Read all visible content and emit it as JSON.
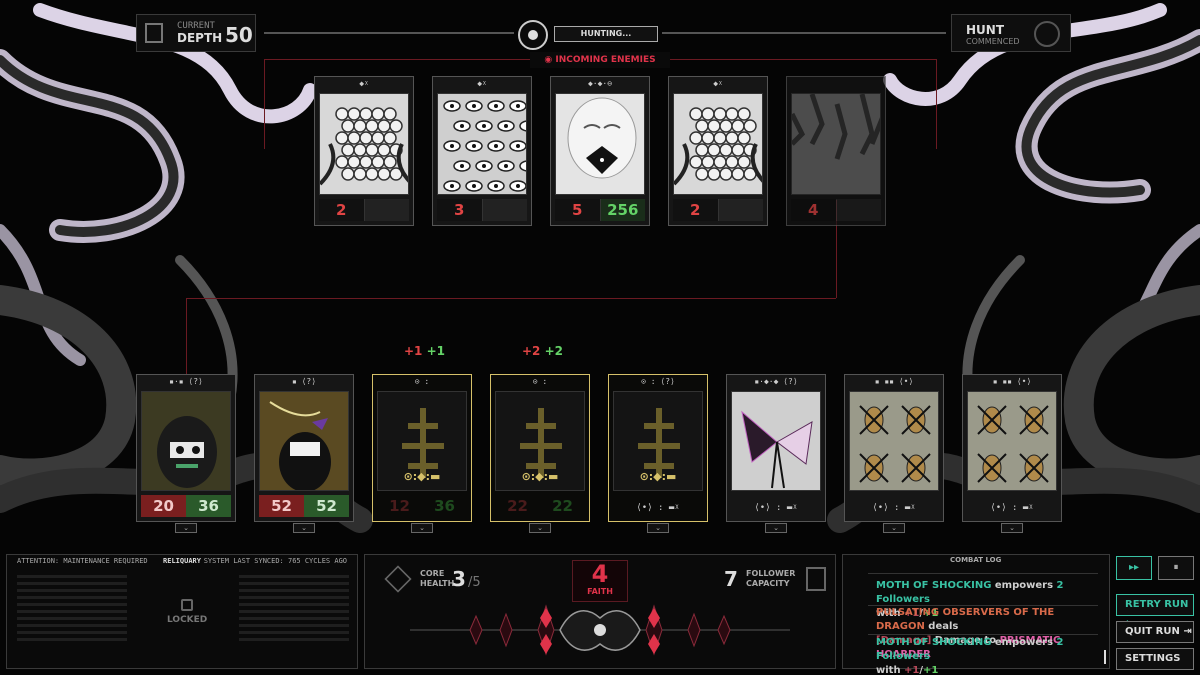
{
  "hud": {
    "depth_label1": "CURRENT",
    "depth_label2": "DEPTH",
    "depth_value": "50",
    "status": "HUNTING...",
    "hunt_label1": "HUNT",
    "hunt_label2": "COMMENCED",
    "incoming": "INCOMING ENEMIES"
  },
  "enemies": [
    {
      "icons": "◆ᵡ",
      "attack": "2",
      "health": "",
      "art": "nest-eggs"
    },
    {
      "icons": "◆ᵡ",
      "attack": "3",
      "health": "",
      "art": "eyes-cluster"
    },
    {
      "icons": "◆·◆·⊖",
      "attack": "5",
      "health": "256",
      "art": "prismatic-hoarder"
    },
    {
      "icons": "◆ᵡ",
      "attack": "2",
      "health": "",
      "art": "nest-eggs"
    },
    {
      "icons": "",
      "attack": "4",
      "health": "",
      "art": "claws-dim"
    }
  ],
  "followers": [
    {
      "icons": "▪·▪ ⟨?⟩",
      "attack": "20",
      "health": "36",
      "locked": false,
      "art": "crying-cultist"
    },
    {
      "icons": "▪ ⟨?⟩",
      "attack": "52",
      "health": "52",
      "locked": false,
      "art": "gold-wizard"
    },
    {
      "icons": "⊙ :",
      "attack": "12",
      "health": "36",
      "locked": true,
      "symbol": "⊙:◆:▬",
      "buff": "+1 +1"
    },
    {
      "icons": "⊙ :",
      "attack": "22",
      "health": "22",
      "locked": true,
      "symbol": "⊙:◆:▬",
      "buff": "+2 +2"
    },
    {
      "icons": "⊙ : ⟨?⟩",
      "attack": "",
      "health": "",
      "locked": true,
      "symbol": "⊙:◆:▬",
      "sym2": "⟨•⟩ : ▬ᵡ"
    },
    {
      "icons": "▪·◆·◆ ⟨?⟩",
      "attack": "",
      "health": "",
      "locked": false,
      "art": "moth-of-shocking",
      "sym2": "⟨•⟩ : ▬ᵡ"
    },
    {
      "icons": "▪ ▪▪ ⟨•⟩",
      "attack": "",
      "health": "",
      "locked": false,
      "art": "mosquito-swarm",
      "sym2": "⟨•⟩ : ▬ᵡ"
    },
    {
      "icons": "▪ ▪▪ ⟨•⟩",
      "attack": "",
      "health": "",
      "locked": false,
      "art": "mosquito-swarm",
      "sym2": "⟨•⟩ : ▬ᵡ"
    }
  ],
  "reliquary": {
    "title": "RELIQUARY",
    "left_header": "ATTENTION: MAINTENANCE REQUIRED",
    "right_header": "SYSTEM LAST SYNCED: 765 CYCLES AGO",
    "locked": "LOCKED"
  },
  "core": {
    "label1": "CORE",
    "label2": "HEALTH",
    "value": "3",
    "max": "/5"
  },
  "faith": {
    "value": "4",
    "label": "FAITH"
  },
  "follower_capacity": {
    "value": "7",
    "label1": "FOLLOWER",
    "label2": "CAPACITY"
  },
  "combat_log": {
    "title": "COMBAT LOG",
    "entries": [
      {
        "actor": "MOTH OF SHOCKING",
        "text1": " empowers ",
        "count": "2",
        "text2": " Followers",
        "text3": "with ",
        "buff1": "+1",
        "slash": "/",
        "buff2": "+1"
      },
      {
        "actor": "PULSATING OBSERVERS OF THE DRAGON",
        "text1": " deals ",
        "dmg": "[Damage]",
        "text2": " Damage to ",
        "target": "PRISMATIC HOARDER"
      },
      {
        "actor": "MOTH OF SHOCKING",
        "text1": " empowers ",
        "count": "2",
        "text2": " Followers",
        "text3": "with ",
        "buff1": "+1",
        "slash": "/",
        "buff2": "+1"
      }
    ]
  },
  "buttons": {
    "retry": "RETRY RUN",
    "quit": "QUIT RUN",
    "settings": "SETTINGS",
    "speed_icon": "fast-forward-icon",
    "pause_icon": "pause-icon"
  },
  "colors": {
    "accent_red": "#e0334a",
    "accent_cyan": "#39c2a4",
    "locked_gold": "#d6c16a",
    "attack_red": "#7a1f1f",
    "health_green": "#2a5a2a"
  }
}
